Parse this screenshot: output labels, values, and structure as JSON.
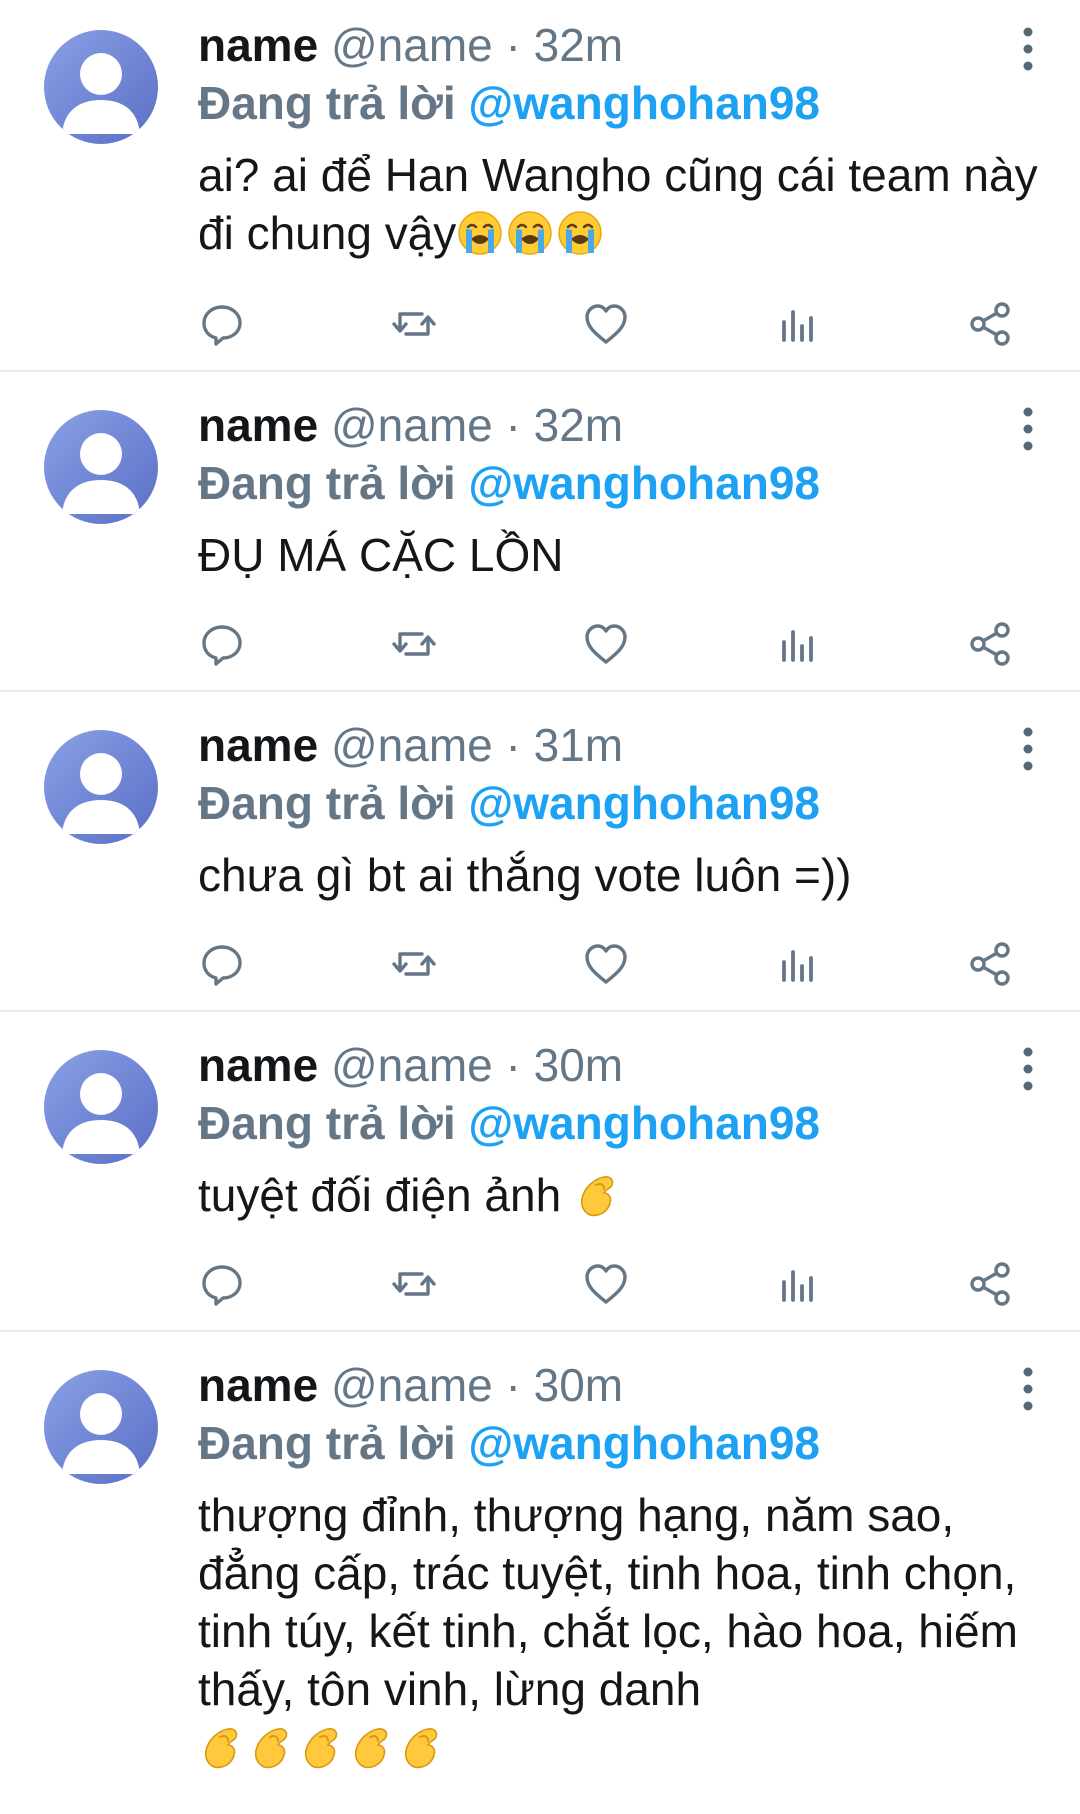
{
  "colors": {
    "accent": "#1da1f2",
    "muted": "#657786",
    "text": "#14171a",
    "avatar_start": "#7b8fdc",
    "avatar_end": "#5b73c6"
  },
  "tweets": [
    {
      "name": "name",
      "handle": "@name",
      "sep": "·",
      "time": "32m",
      "reply_prefix": "Đang trả lời",
      "reply_to": "@wanghohan98",
      "text": "ai? ai để Han Wangho cũng cái team này đi chung vậy",
      "emoji": [
        "loudly-crying-face",
        "loudly-crying-face",
        "loudly-crying-face"
      ]
    },
    {
      "name": "name",
      "handle": "@name",
      "sep": "·",
      "time": "32m",
      "reply_prefix": "Đang trả lời",
      "reply_to": "@wanghohan98",
      "text": "ĐỤ MÁ CẶC LỒN",
      "emoji": []
    },
    {
      "name": "name",
      "handle": "@name",
      "sep": "·",
      "time": "31m",
      "reply_prefix": "Đang trả lời",
      "reply_to": "@wanghohan98",
      "text": "chưa gì bt ai thắng vote luôn =))",
      "emoji": []
    },
    {
      "name": "name",
      "handle": "@name",
      "sep": "·",
      "time": "30m",
      "reply_prefix": "Đang trả lời",
      "reply_to": "@wanghohan98",
      "text": "tuyệt đối điện ảnh ",
      "emoji": [
        "pinched-fingers"
      ]
    },
    {
      "name": "name",
      "handle": "@name",
      "sep": "·",
      "time": "30m",
      "reply_prefix": "Đang trả lời",
      "reply_to": "@wanghohan98",
      "text": "thượng đỉnh, thượng hạng, năm sao, đẳng cấp, trác tuyệt, tinh hoa, tinh chọn, tinh túy, kết tinh, chắt lọc, hào hoa, hiếm thấy, tôn vinh, lừng danh\n",
      "emoji": [
        "pinched-fingers",
        "pinched-fingers",
        "pinched-fingers",
        "pinched-fingers",
        "pinched-fingers"
      ]
    }
  ],
  "action_icons": [
    "reply-icon",
    "retweet-icon",
    "like-icon",
    "analytics-icon",
    "share-icon"
  ]
}
